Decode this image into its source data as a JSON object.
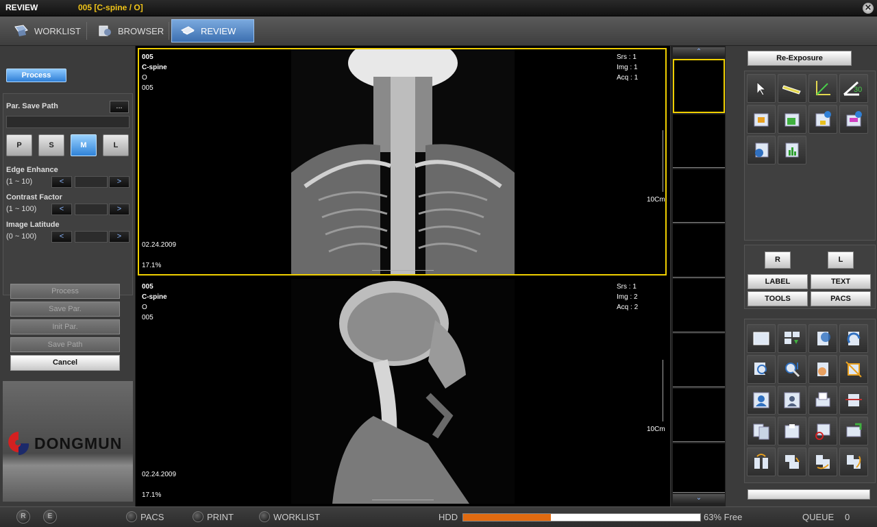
{
  "titlebar": {
    "app": "REVIEW",
    "study": "005 [C-spine / O]"
  },
  "nav": {
    "tabs": [
      {
        "label": "WORKLIST"
      },
      {
        "label": "BROWSER"
      },
      {
        "label": "REVIEW"
      }
    ]
  },
  "left": {
    "process": "Process",
    "par_save_path": "Par. Save Path",
    "browse": "...",
    "sizes": [
      "P",
      "S",
      "M",
      "L"
    ],
    "params": [
      {
        "label": "Edge Enhance",
        "range": "(1 ~ 10)"
      },
      {
        "label": "Contrast Factor",
        "range": "(1 ~ 100)"
      },
      {
        "label": "Image Latitude",
        "range": "(0 ~  100)"
      }
    ],
    "actions": [
      "Process",
      "Save Par.",
      "Init Par.",
      "Save Path"
    ],
    "cancel": "Cancel",
    "logo": "DONGMUN"
  },
  "viewports": [
    {
      "id": "005",
      "body": "C-spine",
      "view": "O",
      "id2": "005",
      "srs": "Srs : 1",
      "img": "Img : 1",
      "acq": "Acq : 1",
      "scale": "10Cm",
      "date": "02.24.2009",
      "zoom": "17.1%"
    },
    {
      "id": "005",
      "body": "C-spine",
      "view": "O",
      "id2": "005",
      "srs": "Srs : 1",
      "img": "Img : 2",
      "acq": "Acq : 2",
      "scale": "10Cm",
      "date": "02.24.2009",
      "zoom": "17.1%"
    }
  ],
  "thumbs": {
    "page": "1"
  },
  "right": {
    "reexposure": "Re-Exposure",
    "r": "R",
    "l": "L",
    "label": "LABEL",
    "text": "TEXT",
    "tools": "TOOLS",
    "pacs": "PACS"
  },
  "status": {
    "r": "R",
    "e": "E",
    "pacs": "PACS",
    "print": "PRINT",
    "worklist": "WORKLIST",
    "hdd": "HDD",
    "hdd_free": "63% Free",
    "hdd_used_fraction": 0.37,
    "queue": "QUEUE",
    "queue_count": "0",
    "accent": "#f0c419",
    "hdd_fill": "#e06a10"
  }
}
